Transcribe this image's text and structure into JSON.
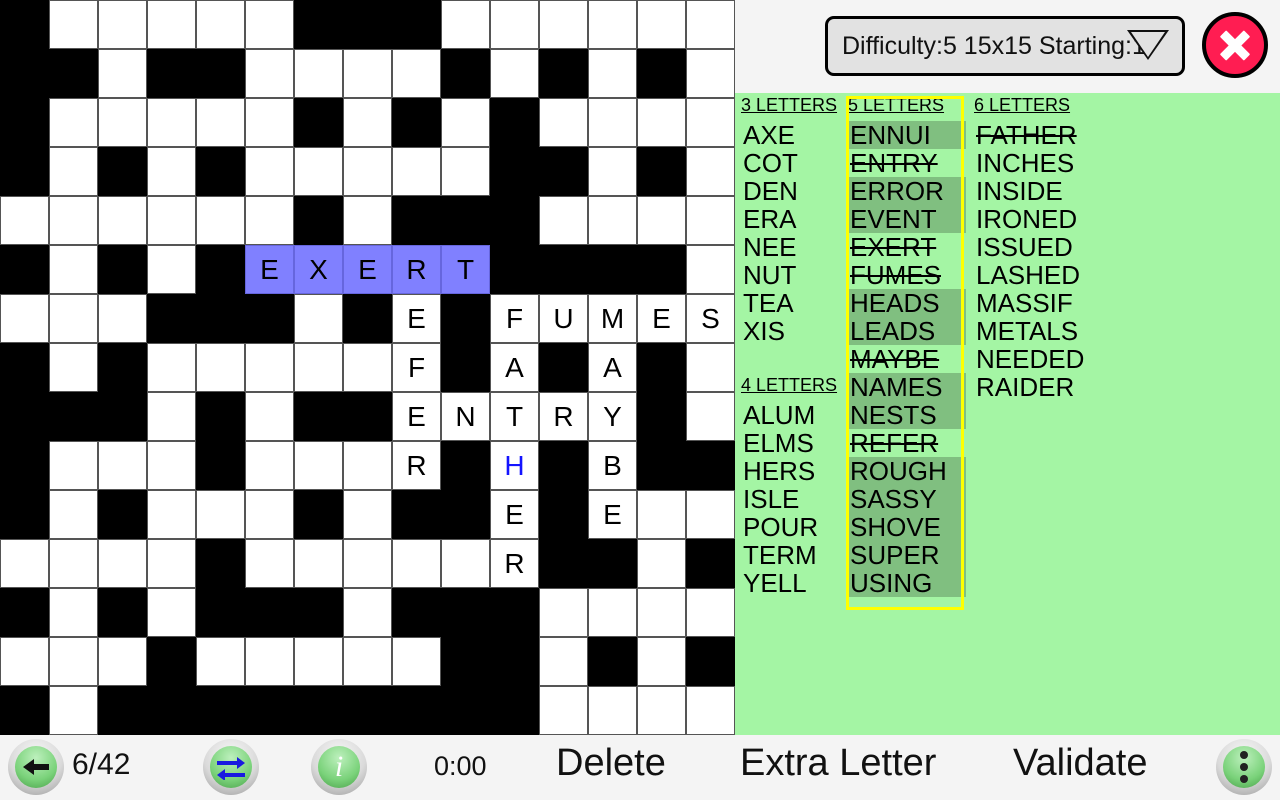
{
  "header": {
    "difficulty_text": "Difficulty:5  15x15  Starting:1",
    "dropdown_icon": "chevron-down-icon",
    "close_icon": "close-icon",
    "close_color": "#ff1d52"
  },
  "grid": {
    "size": "15x15",
    "selection_color": "#8080ff",
    "pending_letter_color": "#1414ff",
    "rows": [
      "#.....###......",
      "##.##....#.#.#.",
      "#.....#.#.#....",
      "#.#.#.....##.#.",
      "......#.###....",
      "#.#.#EXERT####.",
      "...###.#E#FUMES",
      "#.#.....F#A#A#.",
      "###.#.##ENTRY#.",
      "#...#...R#H#B##",
      "#.#...#.##E#E..",
      "....#.....R##.#",
      "#.#.###.###....",
      "...#.....##.#.#",
      "#.#########....."
    ],
    "letters": [
      {
        "r": 5,
        "c": 5,
        "ch": "E",
        "state": "selected"
      },
      {
        "r": 5,
        "c": 6,
        "ch": "X",
        "state": "selected"
      },
      {
        "r": 5,
        "c": 7,
        "ch": "E",
        "state": "selected"
      },
      {
        "r": 5,
        "c": 8,
        "ch": "R",
        "state": "selected"
      },
      {
        "r": 5,
        "c": 9,
        "ch": "T",
        "state": "selected"
      },
      {
        "r": 6,
        "c": 8,
        "ch": "E",
        "state": "placed"
      },
      {
        "r": 6,
        "c": 10,
        "ch": "F",
        "state": "placed"
      },
      {
        "r": 6,
        "c": 11,
        "ch": "U",
        "state": "placed"
      },
      {
        "r": 6,
        "c": 12,
        "ch": "M",
        "state": "placed"
      },
      {
        "r": 6,
        "c": 13,
        "ch": "E",
        "state": "placed"
      },
      {
        "r": 6,
        "c": 14,
        "ch": "S",
        "state": "placed"
      },
      {
        "r": 7,
        "c": 8,
        "ch": "F",
        "state": "placed"
      },
      {
        "r": 7,
        "c": 10,
        "ch": "A",
        "state": "placed"
      },
      {
        "r": 7,
        "c": 12,
        "ch": "A",
        "state": "placed"
      },
      {
        "r": 8,
        "c": 8,
        "ch": "E",
        "state": "placed"
      },
      {
        "r": 8,
        "c": 9,
        "ch": "N",
        "state": "placed"
      },
      {
        "r": 8,
        "c": 10,
        "ch": "T",
        "state": "placed"
      },
      {
        "r": 8,
        "c": 11,
        "ch": "R",
        "state": "placed"
      },
      {
        "r": 8,
        "c": 12,
        "ch": "Y",
        "state": "placed"
      },
      {
        "r": 9,
        "c": 8,
        "ch": "R",
        "state": "placed"
      },
      {
        "r": 9,
        "c": 10,
        "ch": "H",
        "state": "pending"
      },
      {
        "r": 9,
        "c": 12,
        "ch": "B",
        "state": "placed"
      },
      {
        "r": 10,
        "c": 10,
        "ch": "E",
        "state": "placed"
      },
      {
        "r": 10,
        "c": 12,
        "ch": "E",
        "state": "placed"
      },
      {
        "r": 11,
        "c": 10,
        "ch": "R",
        "state": "placed"
      }
    ]
  },
  "word_panel": {
    "background": "#a4f5a4",
    "highlight_color": "#80bf80",
    "selection_border": "#ffff00",
    "columns": [
      {
        "id": "col3",
        "groups": [
          {
            "heading": "3 LETTERS",
            "words": [
              {
                "text": "AXE",
                "used": false,
                "highlighted": false
              },
              {
                "text": "COT",
                "used": false,
                "highlighted": false
              },
              {
                "text": "DEN",
                "used": false,
                "highlighted": false
              },
              {
                "text": "ERA",
                "used": false,
                "highlighted": false
              },
              {
                "text": "NEE",
                "used": false,
                "highlighted": false
              },
              {
                "text": "NUT",
                "used": false,
                "highlighted": false
              },
              {
                "text": "TEA",
                "used": false,
                "highlighted": false
              },
              {
                "text": "XIS",
                "used": false,
                "highlighted": false
              }
            ]
          },
          {
            "heading": "4 LETTERS",
            "words": [
              {
                "text": "ALUM",
                "used": false,
                "highlighted": false
              },
              {
                "text": "ELMS",
                "used": false,
                "highlighted": false
              },
              {
                "text": "HERS",
                "used": false,
                "highlighted": false
              },
              {
                "text": "ISLE",
                "used": false,
                "highlighted": false
              },
              {
                "text": "POUR",
                "used": false,
                "highlighted": false
              },
              {
                "text": "TERM",
                "used": false,
                "highlighted": false
              },
              {
                "text": "YELL",
                "used": false,
                "highlighted": false
              }
            ]
          }
        ]
      },
      {
        "id": "col5",
        "selected": true,
        "groups": [
          {
            "heading": "5 LETTERS",
            "words": [
              {
                "text": "ENNUI",
                "used": false,
                "highlighted": true
              },
              {
                "text": "ENTRY",
                "used": true,
                "highlighted": false
              },
              {
                "text": "ERROR",
                "used": false,
                "highlighted": true
              },
              {
                "text": "EVENT",
                "used": false,
                "highlighted": true
              },
              {
                "text": "EXERT",
                "used": true,
                "highlighted": false
              },
              {
                "text": "FUMES",
                "used": true,
                "highlighted": false
              },
              {
                "text": "HEADS",
                "used": false,
                "highlighted": true
              },
              {
                "text": "LEADS",
                "used": false,
                "highlighted": true
              },
              {
                "text": "MAYBE",
                "used": true,
                "highlighted": false
              },
              {
                "text": "NAMES",
                "used": false,
                "highlighted": true
              },
              {
                "text": "NESTS",
                "used": false,
                "highlighted": true
              },
              {
                "text": "REFER",
                "used": true,
                "highlighted": false
              },
              {
                "text": "ROUGH",
                "used": false,
                "highlighted": true
              },
              {
                "text": "SASSY",
                "used": false,
                "highlighted": true
              },
              {
                "text": "SHOVE",
                "used": false,
                "highlighted": true
              },
              {
                "text": "SUPER",
                "used": false,
                "highlighted": true
              },
              {
                "text": "USING",
                "used": false,
                "highlighted": true
              }
            ]
          }
        ]
      },
      {
        "id": "col6",
        "groups": [
          {
            "heading": "6 LETTERS",
            "words": [
              {
                "text": "FATHER",
                "used": true,
                "highlighted": false
              },
              {
                "text": "INCHES",
                "used": false,
                "highlighted": false
              },
              {
                "text": "INSIDE",
                "used": false,
                "highlighted": false
              },
              {
                "text": "IRONED",
                "used": false,
                "highlighted": false
              },
              {
                "text": "ISSUED",
                "used": false,
                "highlighted": false
              },
              {
                "text": "LASHED",
                "used": false,
                "highlighted": false
              },
              {
                "text": "MASSIF",
                "used": false,
                "highlighted": false
              },
              {
                "text": "METALS",
                "used": false,
                "highlighted": false
              },
              {
                "text": "NEEDED",
                "used": false,
                "highlighted": false
              },
              {
                "text": "RAIDER",
                "used": false,
                "highlighted": false
              }
            ]
          }
        ]
      }
    ]
  },
  "toolbar": {
    "back_icon": "arrow-left-icon",
    "counter": "6/42",
    "swap_icon": "swap-arrows-icon",
    "info_icon": "info-icon",
    "timer": "0:00",
    "delete_label": "Delete",
    "extra_letter_label": "Extra Letter",
    "validate_label": "Validate",
    "menu_icon": "more-vertical-icon"
  }
}
